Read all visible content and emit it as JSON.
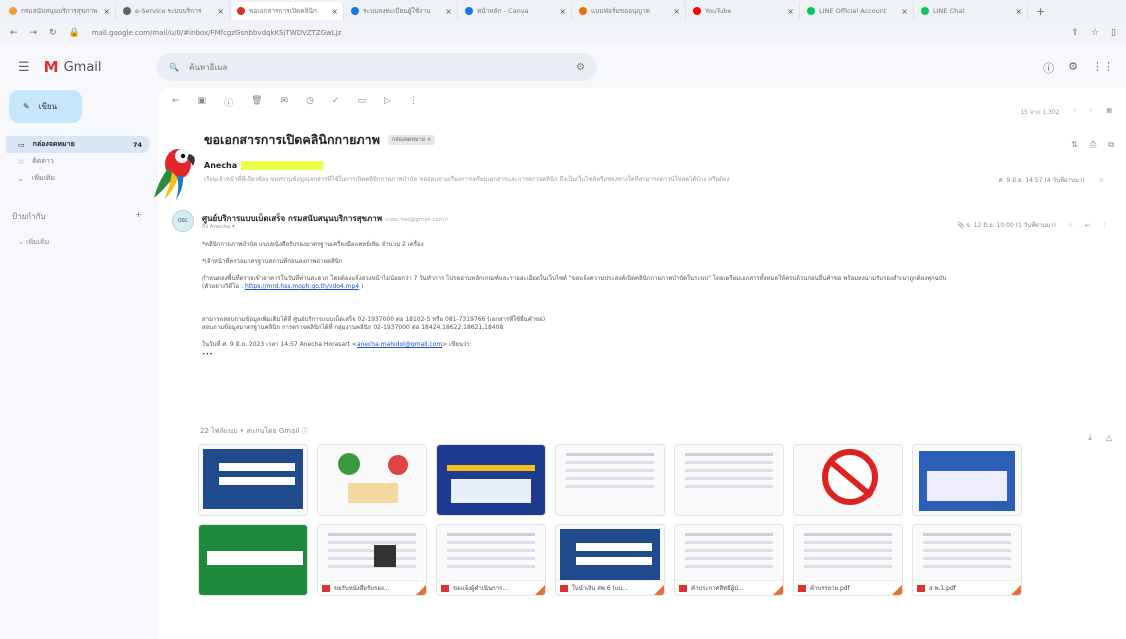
{
  "browser": {
    "tabs": [
      {
        "title": "กรมสนับสนุนบริการสุขภาพ",
        "color": "#f0a030"
      },
      {
        "title": "e-Service ระบบบริการ",
        "color": "#5f6368"
      },
      {
        "title": "ขอเอกสารการเปิดคลินิก",
        "color": "#d93025"
      },
      {
        "title": "ระบบลงทะเบียนผู้ใช้งาน",
        "color": "#1a73e8"
      },
      {
        "title": "หน้าหลัก - Canva",
        "color": "#1a73e8"
      },
      {
        "title": "แบบฟอร์มขออนุญาต",
        "color": "#e8710a"
      },
      {
        "title": "YouTube",
        "color": "#ff0000"
      },
      {
        "title": "LINE Official Account",
        "color": "#06c755"
      },
      {
        "title": "LINE Chat",
        "color": "#06c755"
      }
    ],
    "url": "mail.google.com/mail/u/0/#inbox/FMfcgzGsnbbvdqkKSjTWDVZTZGwLjz"
  },
  "gmail": {
    "logo_text": "Gmail",
    "search_placeholder": "ค้นหาอีเมล",
    "compose_label": "เขียน",
    "nav": [
      {
        "label": "กล่องจดหมาย",
        "count": "74",
        "icon": "inbox-icon",
        "selected": true
      },
      {
        "label": "ติดดาว",
        "count": "",
        "icon": "star-icon",
        "selected": false
      },
      {
        "label": "เพิ่มเติม",
        "count": "",
        "icon": "chevron-down-icon",
        "selected": false
      }
    ],
    "labels_heading": "ป้ายกำกับ",
    "labels_more": "เพิ่มเติม"
  },
  "thread": {
    "subject": "ขอเอกสารการเปิดคลินิกกายภาพ",
    "label_chip": "กล่องจดหมาย ×",
    "pagination": "15 จาก 1,302",
    "msg1": {
      "sender": "Anecha",
      "snippet": "เรียนเจ้าหน้าที่ที่เกี่ยวข้อง ขอทราบข้อมูลเอกสารที่ใช้ในการเปิดคลินิกกายภาพบำบัด ขอสอบถามเรื่องการเตรียมเอกสารและการตรวจคลินิก ถึงเป็นเว็บไซต์หรือช่องทางใดที่สามารถดาวน์โหลดได้บ้าง หรือต้อง",
      "time": "ศ. 9 มิ.ย. 14:57 (4 วันที่ผ่านมา)"
    },
    "msg2": {
      "sender": "ศูนย์บริการแบบเบ็ดเสร็จ กรมสนับสนุนบริการสุขภาพ",
      "sender_email": "<osc.hss@gmail.com>",
      "to": "ถึง Anecha ▾",
      "time": "จ. 12 มิ.ย. 10:00 (1 วันที่ผ่านมา)",
      "avatar_text": "OSC",
      "line1": "*คลินิกกายภาพบำบัด แนบหนังสือรับรองมาตรฐานเครื่องมือแพทย์เพิ่ม จำนวน 2 เครื่อง",
      "line2": "*เจ้าหน้าที่ตรวจมาตรฐานสถานที่ก่อนลงภาพถ่ายคลินิก",
      "line3": "กำหนดลงพื้นที่ตรวจเข้าอาคารในวันที่ท่านสะดวก โดยต้องแจ้งล่วงหน้าไม่น้อยกว่า 7 วันทำการ โปรดอ่านหลักเกณฑ์และรายละเอียดในเว็บไซต์ \"ขอแจ้งความประสงค์เปิดคลินิกกายภาพบำบัดในระบบ\" โดยเตรียมเอกสารทั้งหมดให้ครบถ้วนก่อนยื่นคำขอ พร้อมลงนามรับรองสำเนาถูกต้องทุกฉบับ",
      "line4_prefix": "(ตัวอย่างวิดีโอ :",
      "link": "https://mrd.hss.moph.go.th/vdo4.mp4",
      "line4_suffix": ")",
      "line5": "สามารถสอบถามข้อมูลเพิ่มเติมได้ที่ ศูนย์บริการแบบเบ็ดเสร็จ 02-1937000 ต่อ 18102-5 หรือ 081-7319766 (เอกสารที่ใช้ยื่นคำขอ)",
      "line6": "สอบถามข้อมูลมาตรฐานคลินิก การตรวจคลินิกได้ที่ กลุ่มงานคลินิก 02-1937000 ต่อ 18424,18622,18621,18408",
      "line7_prefix": "ในวันที่ ศ. 9 มิ.ย. 2023 เวลา 14:57 Anecha Horasart <",
      "email": "anecha.mahidol@gmail.com",
      "line7_suffix": "> เขียนว่า:",
      "dots": "•••"
    },
    "attachments_title": "22 ไฟล์แนบ",
    "attachments_sub": "• สแกนโดย Gmail ⓘ",
    "attachments": [
      {
        "name": "",
        "kind": "form"
      },
      {
        "name": "",
        "kind": "poster"
      },
      {
        "name": "",
        "kind": "banner"
      },
      {
        "name": "",
        "kind": "doc"
      },
      {
        "name": "",
        "kind": "doc"
      },
      {
        "name": "",
        "kind": "nosmoking"
      },
      {
        "name": "",
        "kind": "table"
      },
      {
        "name": "",
        "kind": "green-sign"
      },
      {
        "name": "ขอรับหนังสือรับรอง...",
        "kind": "qr"
      },
      {
        "name": "ขอแจ้งผู้ดำเนินการ...",
        "kind": "doc"
      },
      {
        "name": "ใบนำเงิน สพ.6 (แบ...",
        "kind": "form"
      },
      {
        "name": "คำประกาศสิทธิผู้ป่...",
        "kind": "doc"
      },
      {
        "name": "คำบรรยาย.pdf",
        "kind": "doc"
      },
      {
        "name": "ส.พ.1.pdf",
        "kind": "doc"
      }
    ]
  }
}
